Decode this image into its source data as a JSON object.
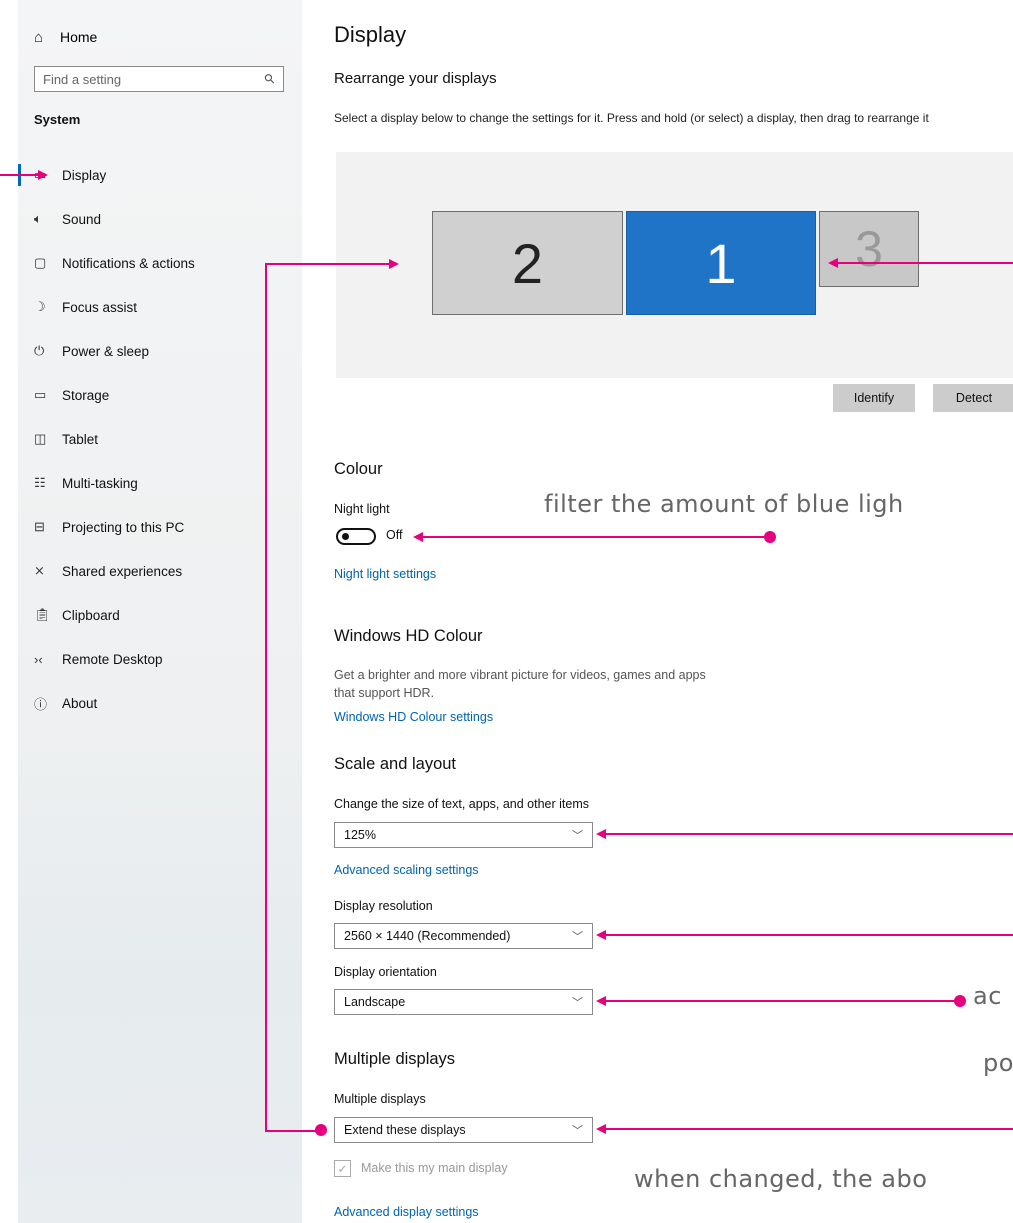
{
  "sidebar": {
    "home_label": "Home",
    "search_placeholder": "Find a setting",
    "section_title": "System",
    "items": [
      {
        "label": "Display",
        "icon": "monitor-icon"
      },
      {
        "label": "Sound",
        "icon": "speaker-icon"
      },
      {
        "label": "Notifications & actions",
        "icon": "message-icon"
      },
      {
        "label": "Focus assist",
        "icon": "moon-icon"
      },
      {
        "label": "Power & sleep",
        "icon": "power-icon"
      },
      {
        "label": "Storage",
        "icon": "storage-icon"
      },
      {
        "label": "Tablet",
        "icon": "tablet-icon"
      },
      {
        "label": "Multi-tasking",
        "icon": "multitask-icon"
      },
      {
        "label": "Projecting to this PC",
        "icon": "projector-icon"
      },
      {
        "label": "Shared experiences",
        "icon": "shared-icon"
      },
      {
        "label": "Clipboard",
        "icon": "clipboard-icon"
      },
      {
        "label": "Remote Desktop",
        "icon": "remote-icon"
      },
      {
        "label": "About",
        "icon": "info-icon"
      }
    ],
    "active_item": "Display"
  },
  "main": {
    "title": "Display",
    "rearrange": {
      "heading": "Rearrange your displays",
      "description": "Select a display below to change the settings for it. Press and hold (or select) a display, then drag to rearrange it",
      "monitors": [
        {
          "number": "2",
          "selected": false
        },
        {
          "number": "1",
          "selected": true
        },
        {
          "number": "3",
          "selected": false
        }
      ],
      "identify_label": "Identify",
      "detect_label": "Detect"
    },
    "colour": {
      "heading": "Colour",
      "night_light_label": "Night light",
      "night_light_state": "Off",
      "night_light_settings_link": "Night light settings"
    },
    "hd_colour": {
      "heading": "Windows HD Colour",
      "description_line1": "Get a brighter and more vibrant picture for videos, games and apps",
      "description_line2": "that support HDR.",
      "settings_link": "Windows HD Colour settings"
    },
    "scale": {
      "heading": "Scale and layout",
      "size_label": "Change the size of text, apps, and other items",
      "size_value": "125%",
      "advanced_scaling_link": "Advanced scaling settings",
      "resolution_label": "Display resolution",
      "resolution_value": "2560 × 1440 (Recommended)",
      "orientation_label": "Display orientation",
      "orientation_value": "Landscape"
    },
    "multiple": {
      "heading": "Multiple displays",
      "label": "Multiple displays",
      "value": "Extend these displays",
      "main_display_checkbox": "Make this my main display",
      "advanced_display_link": "Advanced display settings"
    }
  },
  "annotations": {
    "night_light_note": "filter the amount of blue ligh",
    "orientation_note": "ac",
    "orientation_note2": "po",
    "multiple_note": "when changed, the abo"
  },
  "colors": {
    "accent": "#0067c0",
    "selected_monitor": "#2074c8",
    "annotation": "#e6007e",
    "link": "#0063b1"
  }
}
